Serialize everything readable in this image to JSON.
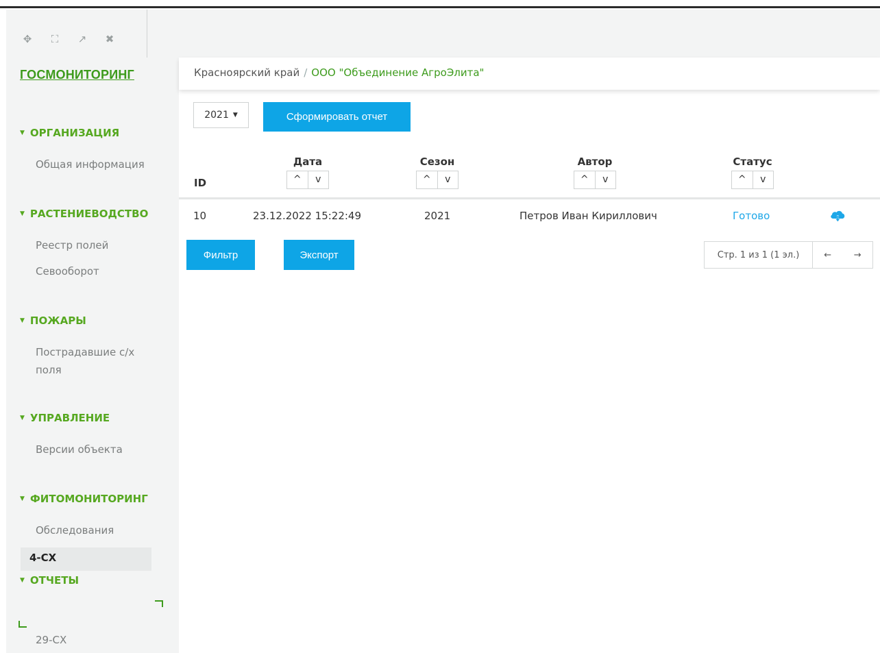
{
  "window_controls": [
    {
      "icon": "move-icon",
      "glyph": "✥"
    },
    {
      "icon": "fullscreen-icon",
      "glyph": "⛶"
    },
    {
      "icon": "open-external-icon",
      "glyph": "↗"
    },
    {
      "icon": "close-icon",
      "glyph": "✖"
    }
  ],
  "sidebar": {
    "brand": "ГОСМОНИТОРИНГ",
    "sections": [
      {
        "title": "ОРГАНИЗАЦИЯ",
        "items": [
          "Общая информация"
        ]
      },
      {
        "title": "РАСТЕНИЕВОДСТВО",
        "items": [
          "Реестр полей",
          "Севооборот"
        ]
      },
      {
        "title": "ПОЖАРЫ",
        "items": [
          "Пострадавшие с/х поля"
        ]
      },
      {
        "title": "УПРАВЛЕНИЕ",
        "items": [
          "Версии объекта"
        ]
      },
      {
        "title": "ФИТОМОНИТОРИНГ",
        "items": [
          "Обследования"
        ]
      },
      {
        "title": "ОТЧЕТЫ",
        "items": [
          "4-СХ",
          "29-СХ"
        ]
      }
    ],
    "active_item": "4-СХ"
  },
  "breadcrumb": {
    "region": "Красноярский край",
    "separator": "/",
    "organization": "ООО \"Объединение АгроЭлита\""
  },
  "toolbar": {
    "year_value": "2021",
    "report_button": "Сформировать отчет"
  },
  "table": {
    "columns": [
      {
        "key": "id",
        "label": "ID",
        "sortable": false
      },
      {
        "key": "date",
        "label": "Дата",
        "sortable": true
      },
      {
        "key": "season",
        "label": "Сезон",
        "sortable": true
      },
      {
        "key": "author",
        "label": "Автор",
        "sortable": true
      },
      {
        "key": "status",
        "label": "Статус",
        "sortable": true
      }
    ],
    "rows": [
      {
        "id": "10",
        "date": "23.12.2022 15:22:49",
        "season": "2021",
        "author": "Петров Иван Кириллович",
        "status": "Готово",
        "action_icon": "cloud-download-icon"
      }
    ],
    "sort_up": "^",
    "sort_down": "v"
  },
  "actions": {
    "filter_button": "Фильтр",
    "export_button": "Экспорт"
  },
  "pagination": {
    "info": "Стр. 1 из 1 (1 эл.)",
    "prev": "←",
    "next": "→"
  },
  "colors": {
    "accent_green": "#3d9b1c",
    "button_blue": "#0ea5e6",
    "link_blue": "#1ea7e8",
    "sidebar_bg": "#f3f4f4"
  }
}
